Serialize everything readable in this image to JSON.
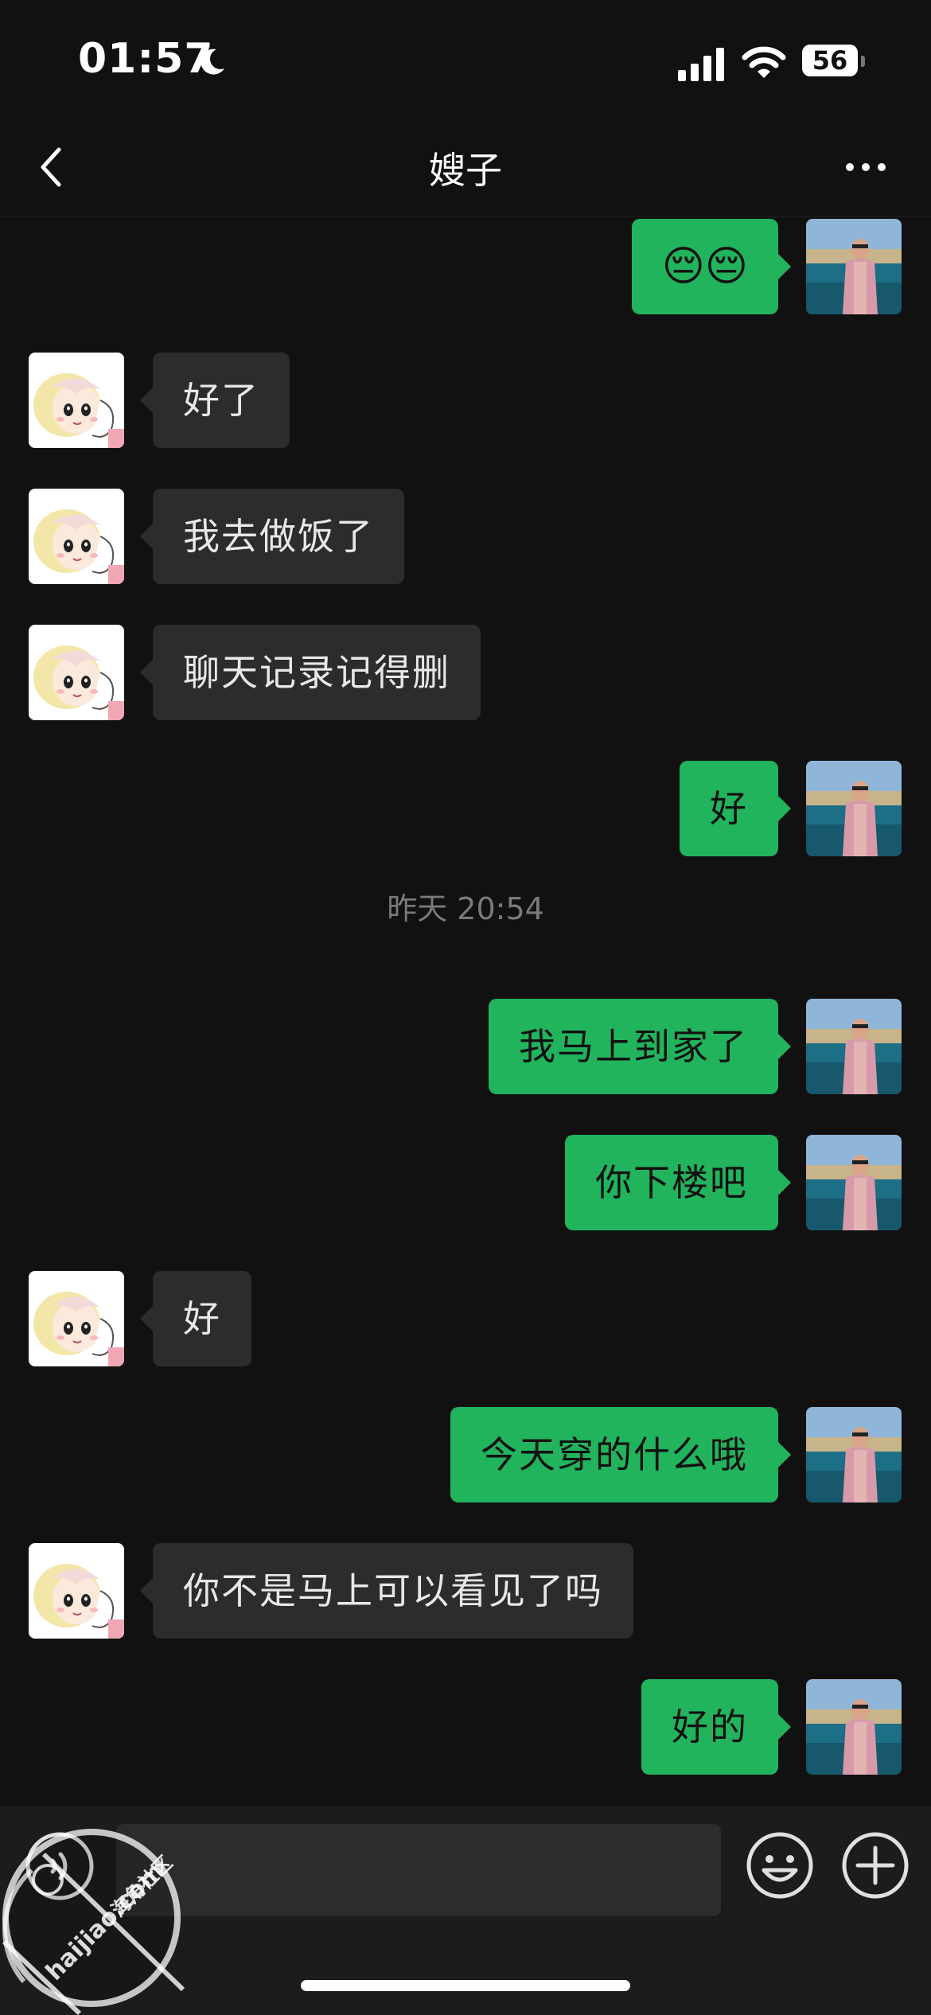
{
  "status_bar": {
    "time": "01:57",
    "battery": "56",
    "icons": [
      "moon-icon",
      "signal-icon",
      "wifi-icon",
      "battery-icon"
    ]
  },
  "nav": {
    "title": "嫂子",
    "back_icon": "chevron-left-icon",
    "more_icon": "more-dots-icon"
  },
  "messages": [
    {
      "side": "right",
      "text": "😔😔",
      "emoji": true
    },
    {
      "side": "left",
      "text": "好了"
    },
    {
      "side": "left",
      "text": "我去做饭了"
    },
    {
      "side": "left",
      "text": "聊天记录记得删"
    },
    {
      "side": "right",
      "text": "好"
    },
    {
      "type": "timestamp",
      "text": "昨天 20:54"
    },
    {
      "side": "right",
      "text": "我马上到家了"
    },
    {
      "side": "right",
      "text": "你下楼吧"
    },
    {
      "side": "left",
      "text": "好"
    },
    {
      "side": "right",
      "text": "今天穿的什么哦"
    },
    {
      "side": "left",
      "text": "你不是马上可以看见了吗"
    },
    {
      "side": "right",
      "text": "好的"
    }
  ],
  "input_bar": {
    "value": "",
    "icons": [
      "voice-icon",
      "emoji-icon",
      "plus-icon"
    ]
  },
  "watermark": {
    "text_cn": "海角社区",
    "text_url": "haijiao.com"
  },
  "colors": {
    "background": "#111111",
    "outgoing_bubble": "#22b35d",
    "incoming_bubble": "#2c2c2c",
    "timestamp_text": "#7a7a7a",
    "input_bar": "#1c1c1c"
  }
}
